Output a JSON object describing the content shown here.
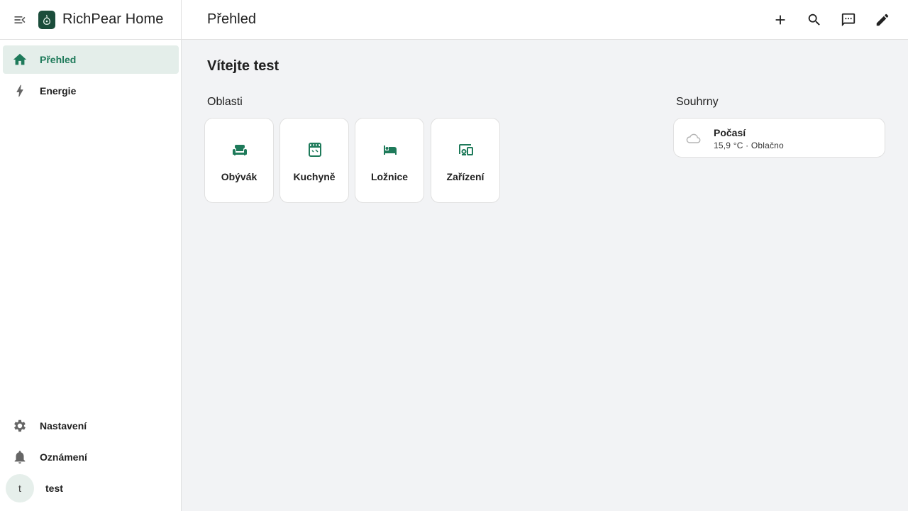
{
  "sidebar": {
    "menu_icon": "menu-open-icon",
    "brand": "RichPear Home",
    "items": [
      {
        "label": "Přehled",
        "icon": "home-icon",
        "active": true
      },
      {
        "label": "Energie",
        "icon": "lightning-icon",
        "active": false
      }
    ],
    "bottom": [
      {
        "label": "Nastavení",
        "icon": "gear-icon"
      },
      {
        "label": "Oznámení",
        "icon": "bell-icon"
      }
    ],
    "user": {
      "initial": "t",
      "name": "test"
    }
  },
  "topbar": {
    "title": "Přehled",
    "actions": [
      "plus-icon",
      "search-icon",
      "assist-chat-icon",
      "pencil-icon"
    ]
  },
  "main": {
    "welcome": "Vítejte test",
    "areas_title": "Oblasti",
    "areas": [
      {
        "label": "Obývák",
        "icon": "sofa-icon"
      },
      {
        "label": "Kuchyně",
        "icon": "stove-icon"
      },
      {
        "label": "Ložnice",
        "icon": "bed-icon"
      },
      {
        "label": "Zařízení",
        "icon": "devices-icon"
      }
    ],
    "summaries_title": "Souhrny",
    "weather": {
      "title": "Počasí",
      "subtitle": "15,9 °C · Oblačno",
      "icon": "cloud-icon"
    }
  },
  "colors": {
    "accent": "#1e7a5a",
    "active_bg": "#e4eeea",
    "background": "#f2f3f5"
  }
}
